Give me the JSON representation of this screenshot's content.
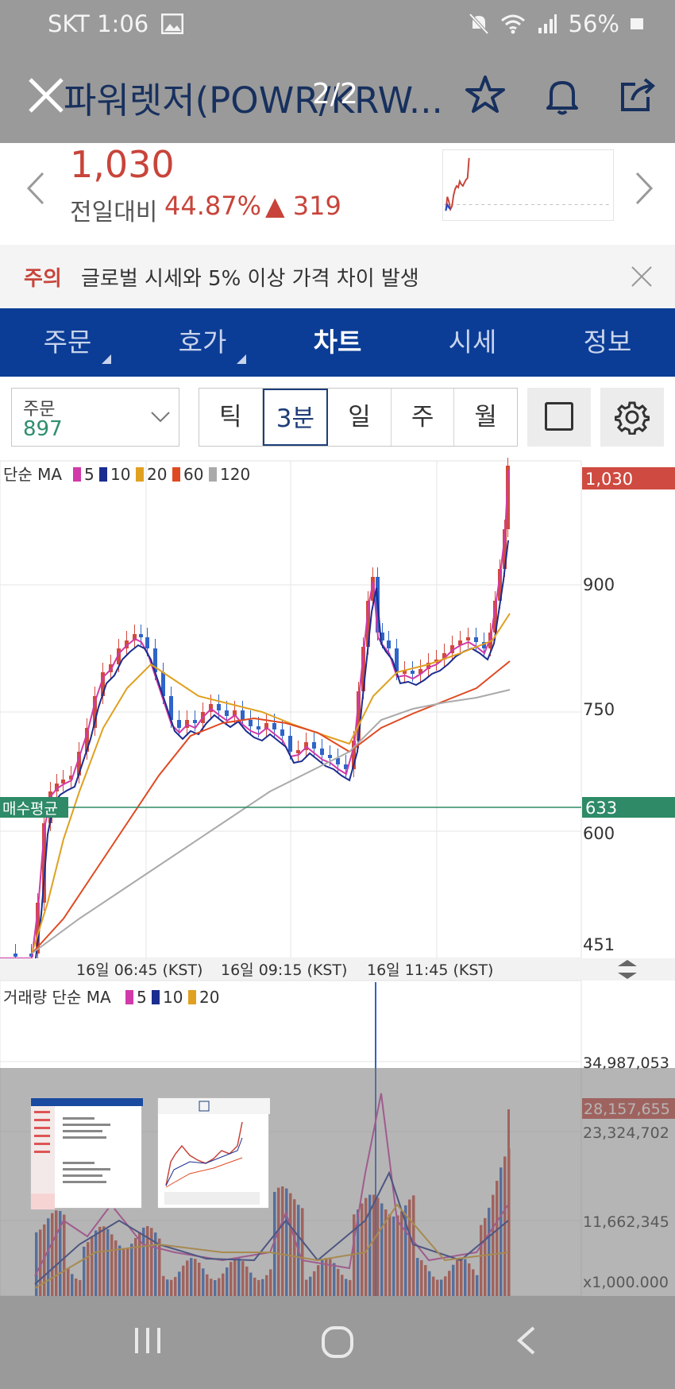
{
  "status": {
    "carrier_time": "SKT 1:06",
    "battery": "56%"
  },
  "viewer": {
    "title": "파워렛저(POWR/KRW...",
    "counter": "2/2"
  },
  "ticker": {
    "price": "1,030",
    "compare_label": "전일대비",
    "percent": "44.87%",
    "change": "▲ 319"
  },
  "notice": {
    "tag": "주의",
    "message": "글로벌 시세와 5% 이상 가격 차이 발생"
  },
  "tabs": [
    {
      "label": "주문",
      "has_menu": true
    },
    {
      "label": "호가",
      "has_menu": true
    },
    {
      "label": "차트",
      "active": true
    },
    {
      "label": "시세"
    },
    {
      "label": "정보"
    }
  ],
  "order": {
    "label": "주문",
    "value": "897"
  },
  "periods": [
    {
      "label": "틱"
    },
    {
      "label": "3분",
      "active": true
    },
    {
      "label": "일"
    },
    {
      "label": "주"
    },
    {
      "label": "월"
    }
  ],
  "price_chart": {
    "legend_title": "단순 MA",
    "ma": [
      {
        "label": "5",
        "color": "#d13aa8"
      },
      {
        "label": "10",
        "color": "#1b2d8f"
      },
      {
        "label": "20",
        "color": "#e0a020"
      },
      {
        "label": "60",
        "color": "#e04a22"
      },
      {
        "label": "120",
        "color": "#aaaaaa"
      }
    ],
    "current_price_tag": "1,030",
    "avg_buy_label": "매수평균",
    "avg_buy_value": "633",
    "y_ticks": [
      "900",
      "750",
      "600",
      "451"
    ],
    "time_labels": [
      "16일 06:45 (KST)",
      "16일 09:15 (KST)",
      "16일 11:45 (KST)"
    ]
  },
  "volume_chart": {
    "legend_title": "거래량 단순 MA",
    "ma": [
      {
        "label": "5",
        "color": "#d13aa8"
      },
      {
        "label": "10",
        "color": "#1b2d8f"
      },
      {
        "label": "20",
        "color": "#e0a020"
      }
    ],
    "y_ticks": [
      "34,987,053",
      "23,324,702",
      "11,662,345"
    ],
    "current_tag": "28,157,655",
    "unit": "x1,000.000"
  }
}
